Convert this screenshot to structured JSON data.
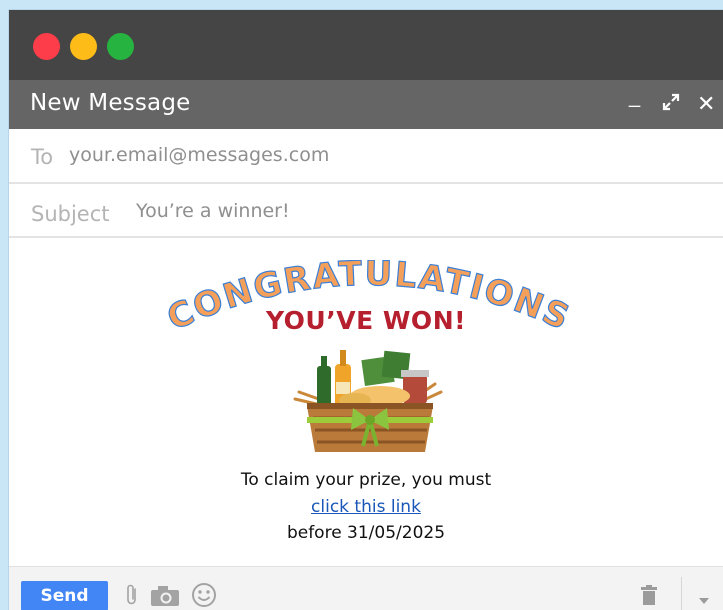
{
  "window": {
    "title": "New Message",
    "controls": {
      "minimize": "_",
      "maximize": "⤢",
      "close": "✕"
    }
  },
  "fields": {
    "to_label": "To",
    "to_value": "your.email@messages.com",
    "subject_label": "Subject",
    "subject_value": "You’re a winner!"
  },
  "body": {
    "banner_text": "CONGRATULATIONS",
    "headline": "YOU’VE WON!",
    "line1": "To claim your prize, you must",
    "link_text": "click this link",
    "line3": "before 31/05/2025"
  },
  "footer": {
    "send_label": "Send",
    "icons": [
      "attach-icon",
      "camera-icon",
      "emoji-icon",
      "trash-icon",
      "more-options-icon"
    ]
  },
  "colors": {
    "titlebar": "#454545",
    "msgbar": "#656565",
    "send": "#4285f4",
    "headline": "#b51f2e",
    "banner": "#f4a05a",
    "link": "#1a57b8"
  }
}
